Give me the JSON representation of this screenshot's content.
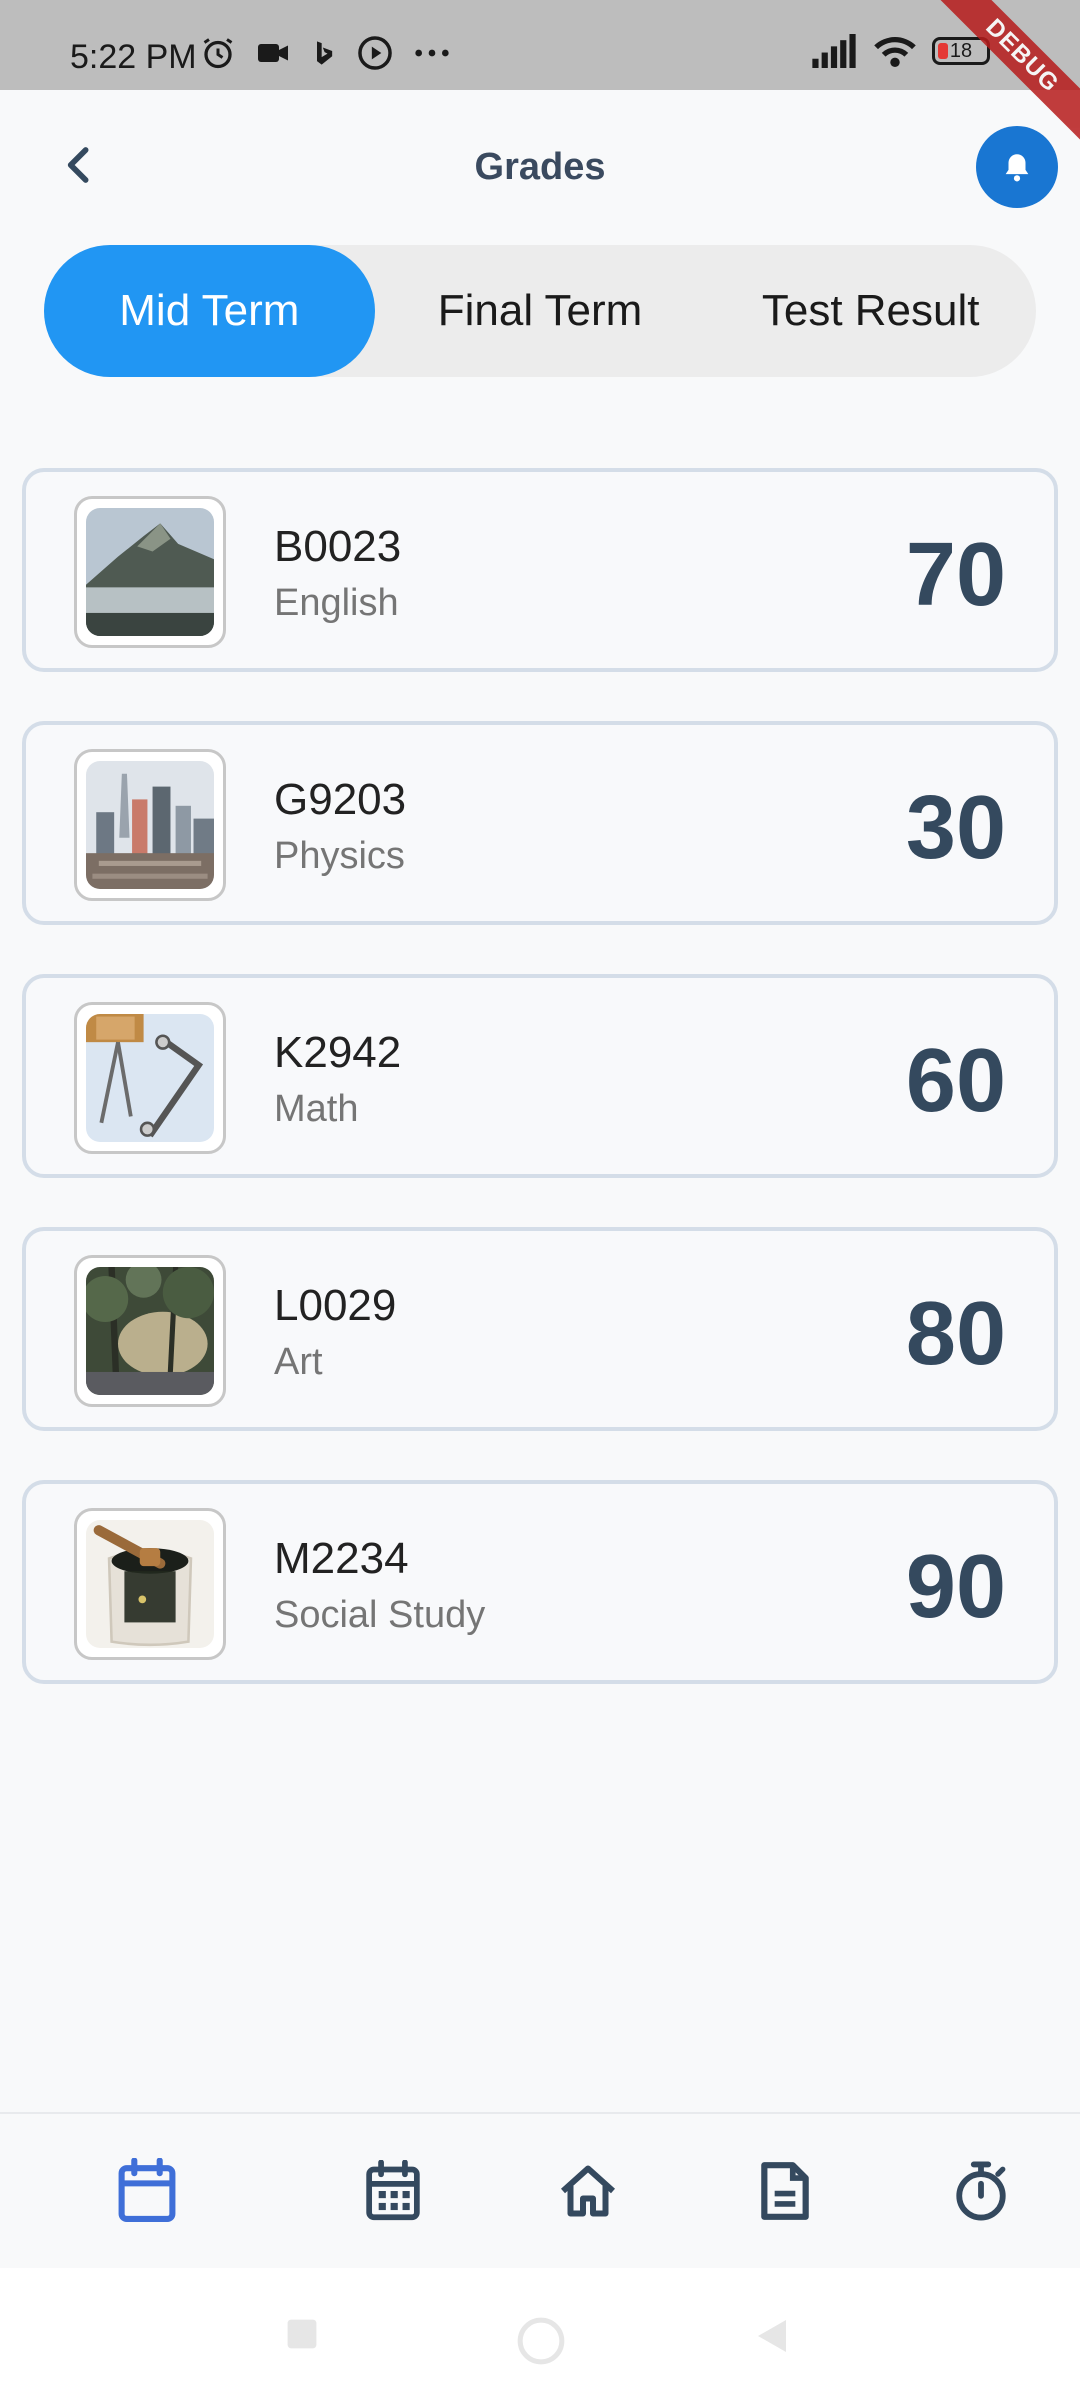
{
  "status_bar": {
    "time": "5:22 PM",
    "battery": "18",
    "icons": [
      "alarm-icon",
      "video-icon",
      "bing-icon",
      "play-circle-icon",
      "more-dots-icon",
      "signal-icon",
      "wifi-icon",
      "battery-icon"
    ]
  },
  "debug_banner": "DEBUG",
  "header": {
    "title": "Grades",
    "back_icon": "chevron-left-icon",
    "notification_icon": "bell-icon",
    "accent": "#1976d2"
  },
  "tabs": [
    {
      "label": "Mid Term",
      "active": true
    },
    {
      "label": "Final Term",
      "active": false
    },
    {
      "label": "Test Result",
      "active": false
    }
  ],
  "grades": [
    {
      "code": "B0023",
      "subject": "English",
      "score": "70",
      "image": "mountain-photo"
    },
    {
      "code": "G9203",
      "subject": "Physics",
      "score": "30",
      "image": "city-photo"
    },
    {
      "code": "K2942",
      "subject": "Math",
      "score": "60",
      "image": "glass-photo"
    },
    {
      "code": "L0029",
      "subject": "Art",
      "score": "80",
      "image": "forest-photo"
    },
    {
      "code": "M2234",
      "subject": "Social Study",
      "score": "90",
      "image": "honey-photo"
    }
  ],
  "bottom_nav": [
    {
      "icon": "calendar-blank-icon",
      "active": true
    },
    {
      "icon": "calendar-grid-icon",
      "active": false
    },
    {
      "icon": "home-icon",
      "active": false
    },
    {
      "icon": "document-icon",
      "active": false
    },
    {
      "icon": "timer-icon",
      "active": false
    }
  ],
  "colors": {
    "tab_active": "#2196f3",
    "score_text": "#34495e",
    "nav_active": "#3f6fd8",
    "nav_inactive": "#34495e"
  }
}
